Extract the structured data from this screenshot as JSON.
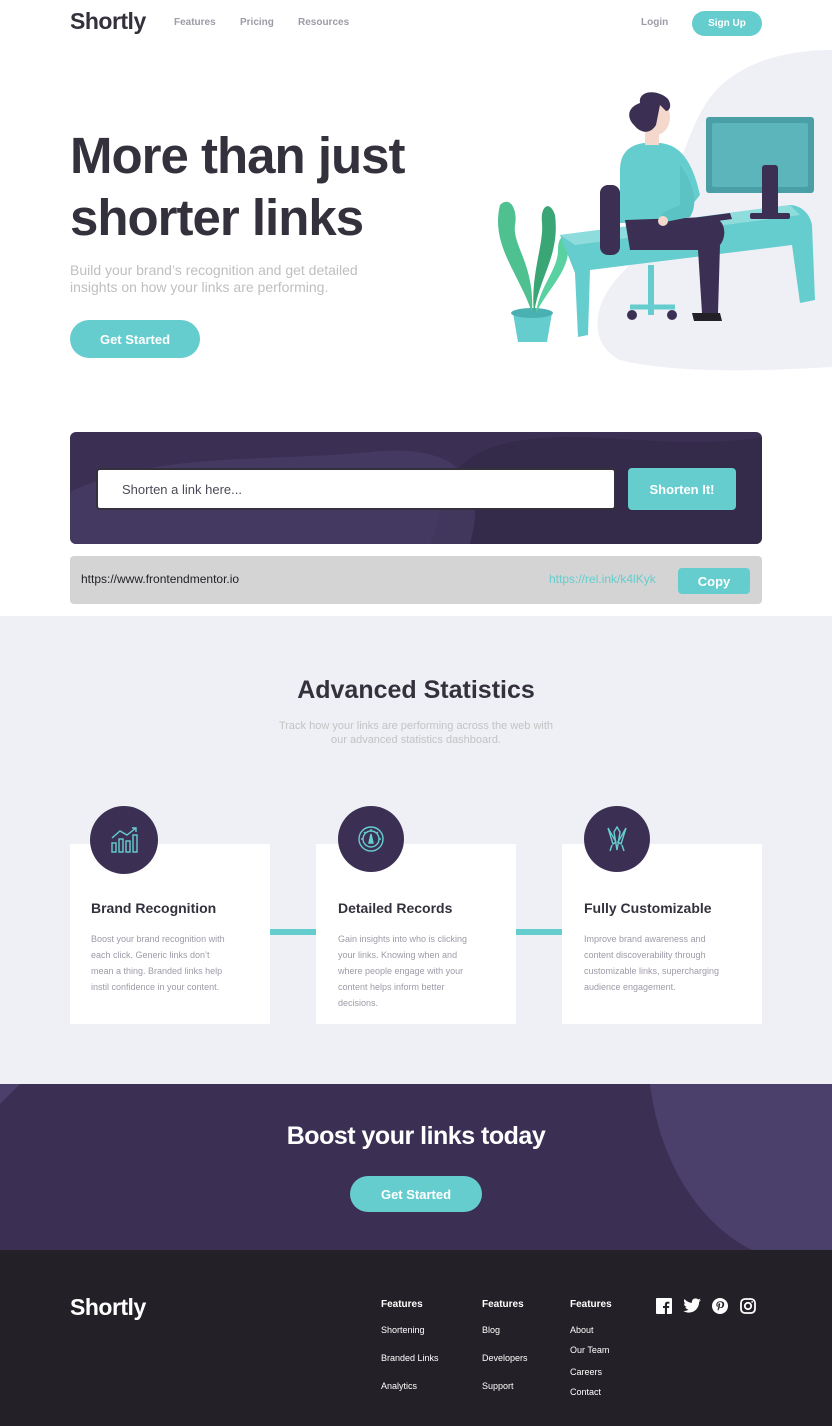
{
  "brand": "Shortly",
  "nav": {
    "links": [
      "Features",
      "Pricing",
      "Resources"
    ],
    "login": "Login",
    "signup": "Sign Up"
  },
  "hero": {
    "title_line1": "More than just",
    "title_line2": "shorter links",
    "subtitle_line1": "Build your brand’s recognition and get detailed",
    "subtitle_line2": "insights on how your links are performing.",
    "cta": "Get Started"
  },
  "shorten": {
    "placeholder": "Shorten a link here...",
    "button": "Shorten It!",
    "result": {
      "original": "https://www.frontendmentor.io",
      "short": "https://rel.ink/k4lKyk",
      "copy": "Copy"
    }
  },
  "stats": {
    "title": "Advanced Statistics",
    "subtitle_line1": "Track how your links are performing across the web with",
    "subtitle_line2": "our advanced statistics dashboard.",
    "cards": [
      {
        "icon": "brand-recognition-icon",
        "title": "Brand Recognition",
        "lines": [
          "Boost your brand recognition with",
          "each click. Generic links don’t",
          "mean a thing. Branded links help",
          "instil confidence in your content."
        ]
      },
      {
        "icon": "detailed-records-icon",
        "title": "Detailed Records",
        "lines": [
          "Gain insights into who is clicking",
          "your links. Knowing when and",
          "where people engage with your",
          "content helps inform better",
          "decisions."
        ]
      },
      {
        "icon": "fully-customizable-icon",
        "title": "Fully Customizable",
        "lines": [
          "Improve brand awareness and",
          "content discoverability through",
          "customizable links, supercharging",
          "audience engagement."
        ]
      }
    ]
  },
  "boost": {
    "title": "Boost your links today",
    "cta": "Get Started"
  },
  "footer": {
    "columns": [
      {
        "heading": "Features",
        "links": [
          "Shortening",
          "Branded Links",
          "Analytics"
        ]
      },
      {
        "heading": "Features",
        "links": [
          "Blog",
          "Developers",
          "Support"
        ]
      },
      {
        "heading": "Features",
        "links": [
          "About",
          "Our Team",
          "Careers",
          "Contact"
        ]
      }
    ],
    "social": [
      "facebook-icon",
      "twitter-icon",
      "pinterest-icon",
      "instagram-icon"
    ]
  },
  "colors": {
    "cyan": "#66cdce",
    "dark_violet": "#3b3054",
    "very_dark": "#232127",
    "gray_bg": "#eff0f6"
  }
}
